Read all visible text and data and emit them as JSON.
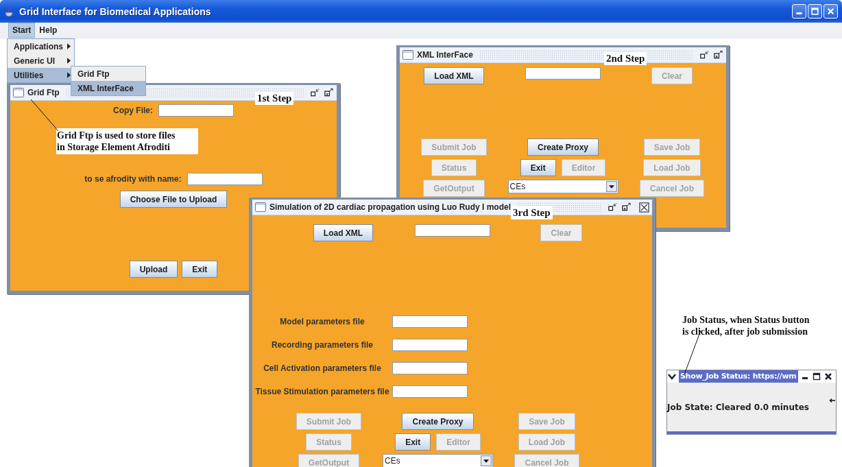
{
  "window": {
    "title": "Grid Interface for Biomedical Applications"
  },
  "menu_bar": [
    {
      "label": "Start",
      "selected": true
    },
    {
      "label": "Help",
      "selected": false
    }
  ],
  "start_menu": [
    {
      "label": "Applications",
      "selected": false,
      "submenu": true
    },
    {
      "label": "Generic UI",
      "selected": false,
      "submenu": true
    },
    {
      "label": "Utilities",
      "selected": true,
      "submenu": true
    }
  ],
  "utilities_menu": [
    {
      "label": "Grid Ftp",
      "selected": false
    },
    {
      "label": "XML InterFace",
      "selected": true
    }
  ],
  "grid_ftp": {
    "title": "Grid Ftp",
    "step": "1st Step",
    "closable": false,
    "note": "Grid Ftp is used to store files\nin Storage Element Afroditi",
    "copy_label": "Copy File:",
    "name_label": "to se afrodity with name:",
    "choose": {
      "label": "Choose File to Upload",
      "disabled": false
    },
    "actions": [
      {
        "label": "Upload",
        "disabled": false
      },
      {
        "label": "Exit",
        "disabled": false
      }
    ]
  },
  "xml_interface": {
    "title": "XML InterFace",
    "step": "2nd Step",
    "closable": false,
    "load": {
      "label": "Load XML",
      "disabled": false
    },
    "clear": {
      "label": "Clear",
      "disabled": true
    },
    "jobs": {
      "left": [
        {
          "label": "Submit Job",
          "disabled": true
        },
        {
          "label": "Status",
          "disabled": true
        },
        {
          "label": "GetOutput",
          "disabled": true
        }
      ],
      "create": {
        "label": "Create Proxy",
        "disabled": false
      },
      "exit": {
        "label": "Exit",
        "disabled": false
      },
      "editor": {
        "label": "Editor",
        "disabled": true
      },
      "ce": {
        "value": "CEs"
      },
      "right": [
        {
          "label": "Save Job",
          "disabled": true
        },
        {
          "label": "Load Job",
          "disabled": true
        },
        {
          "label": "Cancel Job",
          "disabled": true
        }
      ]
    }
  },
  "simulation": {
    "title": "Simulation of 2D cardiac propagation using Luo Rudy I model",
    "step": "3rd Step",
    "closable": true,
    "load": {
      "label": "Load XML",
      "disabled": false
    },
    "clear": {
      "label": "Clear",
      "disabled": true
    },
    "parameters": [
      {
        "label": "Model parameters file"
      },
      {
        "label": "Recording  parameters file"
      },
      {
        "label": "Cell Activation parameters file"
      },
      {
        "label": "Tissue Stimulation parameters file"
      }
    ],
    "jobs": {
      "left": [
        {
          "label": "Submit Job",
          "disabled": true
        },
        {
          "label": "Status",
          "disabled": true
        },
        {
          "label": "GetOutput",
          "disabled": true
        }
      ],
      "create": {
        "label": "Create Proxy",
        "disabled": false
      },
      "exit": {
        "label": "Exit",
        "disabled": false
      },
      "editor": {
        "label": "Editor",
        "disabled": true
      },
      "ce": {
        "value": "CEs"
      },
      "right": [
        {
          "label": "Save Job",
          "disabled": true
        },
        {
          "label": "Load Job",
          "disabled": true
        },
        {
          "label": "Cancel Job",
          "disabled": true
        }
      ]
    }
  },
  "job_status": {
    "note": "Job Status, when Status button\nis clicked, after job submission",
    "title": "Show_Job Status: https://wm",
    "message": "Job State: Cleared 0.0 minutes"
  }
}
